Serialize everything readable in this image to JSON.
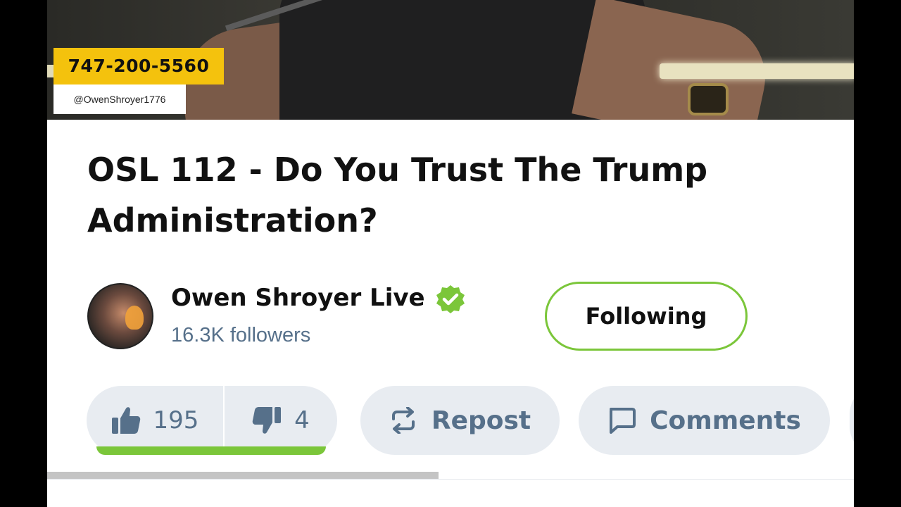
{
  "overlay": {
    "phone": "747-200-5560",
    "handle": "@OwenShroyer1776"
  },
  "video": {
    "title": "OSL 112 - Do You Trust The Trump Administration?"
  },
  "channel": {
    "name": "Owen Shroyer Live",
    "followers": "16.3K followers",
    "verified": true,
    "follow_label": "Following"
  },
  "actions": {
    "likes": "195",
    "dislikes": "4",
    "repost_label": "Repost",
    "comments_label": "Comments"
  },
  "playback": {
    "progress_percent": 48.5
  },
  "colors": {
    "accent_green": "#7bc63a",
    "pill_bg": "#e8ecf1",
    "muted_text": "#56708a",
    "badge_yellow": "#f4c20d"
  },
  "icons": {
    "like": "thumbs-up-icon",
    "dislike": "thumbs-down-icon",
    "repost": "repost-icon",
    "comments": "comment-icon",
    "verified": "verified-check-icon"
  }
}
